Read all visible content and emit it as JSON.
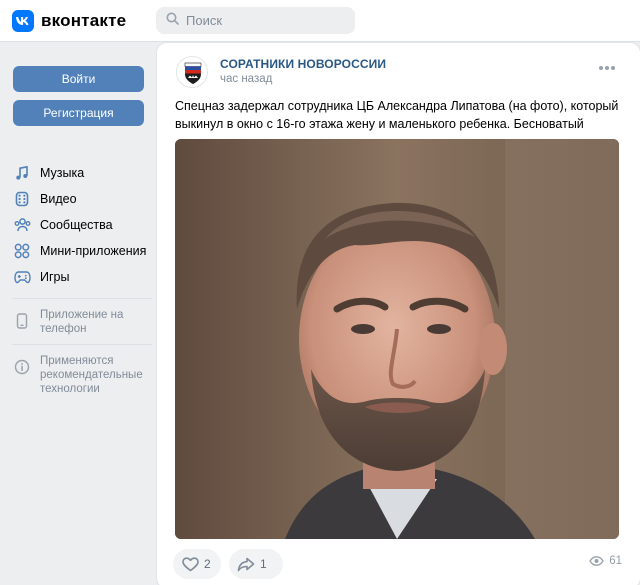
{
  "header": {
    "logo_text": "вконтакте",
    "search_placeholder": "Поиск"
  },
  "sidebar": {
    "login_label": "Войти",
    "register_label": "Регистрация",
    "menu": [
      {
        "label": "Музыка",
        "icon": "music-icon"
      },
      {
        "label": "Видео",
        "icon": "video-icon"
      },
      {
        "label": "Сообщества",
        "icon": "communities-icon"
      },
      {
        "label": "Мини-приложения",
        "icon": "mini-apps-icon"
      },
      {
        "label": "Игры",
        "icon": "games-icon"
      }
    ],
    "app_phone": "Приложение на телефон",
    "recommend_notice": "Применяются рекомендательные технологии"
  },
  "post": {
    "group_name": "СОРАТНИКИ НОВОРОССИИ",
    "time": "час назад",
    "text": "Спецназ задержал сотрудника ЦБ Александра Липатова (на фото), который выкинул в окно с 16-го этажа жену и маленького ребенка. Бесноватый",
    "likes": "2",
    "shares": "1",
    "views": "61"
  },
  "colors": {
    "accent": "#0077ff",
    "button": "#5181b8",
    "link": "#2a5885",
    "muted": "#818c99",
    "background": "#edeef0"
  }
}
